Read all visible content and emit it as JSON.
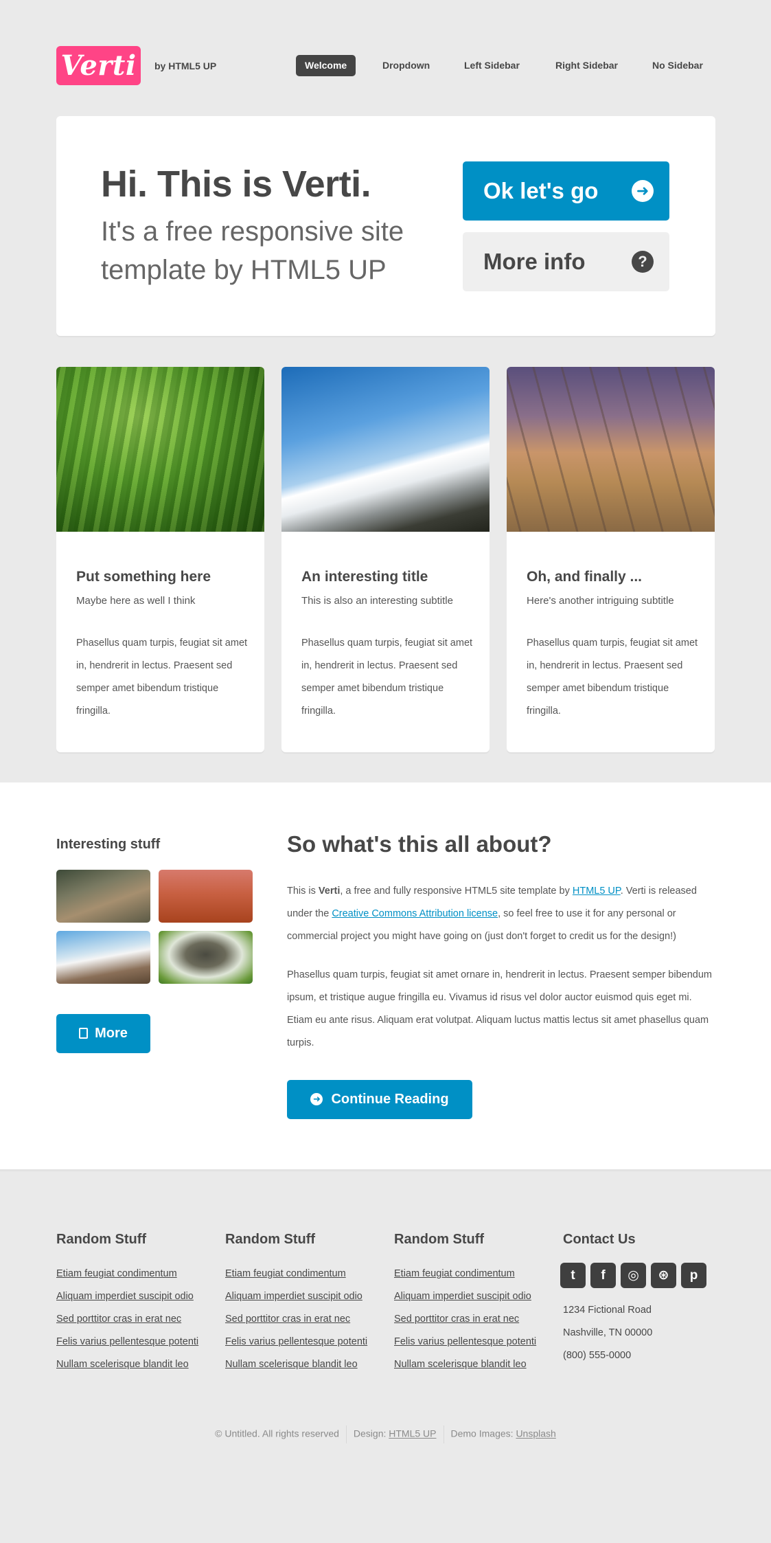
{
  "header": {
    "logo": "Verti",
    "byline": "by HTML5 UP",
    "nav": [
      "Welcome",
      "Dropdown",
      "Left Sidebar",
      "Right Sidebar",
      "No Sidebar"
    ],
    "active_nav": "Welcome"
  },
  "banner": {
    "title": "Hi. This is Verti.",
    "subtitle": "It's a free responsive site template by HTML5 UP",
    "primary_button": "Ok let's go",
    "secondary_button": "More info",
    "primary_icon": "arrow-circle-right-icon",
    "secondary_icon": "question-circle-icon"
  },
  "features": [
    {
      "image": "wheat-field-photo",
      "title": "Put something here",
      "subtitle": "Maybe here as well I think",
      "body": "Phasellus quam turpis, feugiat sit amet in, hendrerit in lectus. Praesent sed semper amet bibendum tristique fringilla."
    },
    {
      "image": "snowy-mountain-photo",
      "title": "An interesting title",
      "subtitle": "This is also an interesting subtitle",
      "body": "Phasellus quam turpis, feugiat sit amet in, hendrerit in lectus. Praesent sed semper amet bibendum tristique fringilla."
    },
    {
      "image": "city-railway-photo",
      "title": "Oh, and finally ...",
      "subtitle": "Here's another intriguing subtitle",
      "body": "Phasellus quam turpis, feugiat sit amet in, hendrerit in lectus. Praesent sed semper amet bibendum tristique fringilla."
    }
  ],
  "sidebar": {
    "title": "Interesting stuff",
    "thumbnails": [
      "forest-boardwalk-photo",
      "autumn-leaves-photo",
      "mountain-peak-photo",
      "stones-on-grass-photo"
    ],
    "more_button": "More"
  },
  "content": {
    "title": "So what's this all about?",
    "p1_pre": "This is ",
    "p1_bold": "Verti",
    "p1_mid": ", a free and fully responsive HTML5 site template by ",
    "p1_link1": "HTML5 UP",
    "p1_mid2": ". Verti is released under the ",
    "p1_link2": "Creative Commons Attribution license",
    "p1_post": ", so feel free to use it for any personal or commercial project you might have going on (just don't forget to credit us for the design!)",
    "p2": "Phasellus quam turpis, feugiat sit amet ornare in, hendrerit in lectus. Praesent semper bibendum ipsum, et tristique augue fringilla eu. Vivamus id risus vel dolor auctor euismod quis eget mi. Etiam eu ante risus. Aliquam erat volutpat. Aliquam luctus mattis lectus sit amet phasellus quam turpis.",
    "continue_button": "Continue Reading"
  },
  "footer": {
    "columns": [
      {
        "title": "Random Stuff",
        "links": [
          "Etiam feugiat condimentum",
          "Aliquam imperdiet suscipit odio",
          "Sed porttitor cras in erat nec",
          "Felis varius pellentesque potenti",
          "Nullam scelerisque blandit leo"
        ]
      },
      {
        "title": "Random Stuff",
        "links": [
          "Etiam feugiat condimentum",
          "Aliquam imperdiet suscipit odio",
          "Sed porttitor cras in erat nec",
          "Felis varius pellentesque potenti",
          "Nullam scelerisque blandit leo"
        ]
      },
      {
        "title": "Random Stuff",
        "links": [
          "Etiam feugiat condimentum",
          "Aliquam imperdiet suscipit odio",
          "Sed porttitor cras in erat nec",
          "Felis varius pellentesque potenti",
          "Nullam scelerisque blandit leo"
        ]
      }
    ],
    "contact": {
      "title": "Contact Us",
      "social": [
        "twitter-icon",
        "facebook-icon",
        "instagram-icon",
        "dribbble-icon",
        "pinterest-icon"
      ],
      "address_line1": "1234 Fictional Road",
      "address_line2": "Nashville, TN 00000",
      "phone": "(800) 555-0000"
    },
    "copyright": "© Untitled. All rights reserved",
    "design_label": "Design: ",
    "design_link": "HTML5 UP",
    "images_label": "Demo Images: ",
    "images_link": "Unsplash"
  },
  "colors": {
    "brand": "#ff4486",
    "accent": "#0090c5",
    "text": "#474747",
    "background": "#eaeaea"
  }
}
